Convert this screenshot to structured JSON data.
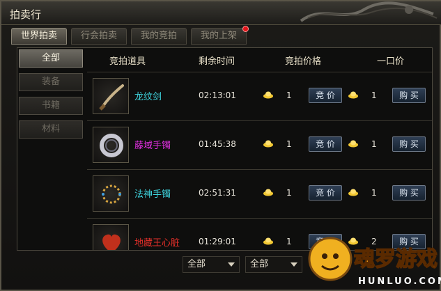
{
  "window": {
    "title": "拍卖行"
  },
  "tabs": [
    {
      "label": "世界拍卖",
      "active": true
    },
    {
      "label": "行会拍卖",
      "active": false
    },
    {
      "label": "我的竞拍",
      "active": false
    },
    {
      "label": "我的上架",
      "active": false,
      "has_notification": true
    }
  ],
  "categories": [
    {
      "label": "全部",
      "active": true
    },
    {
      "label": "装备",
      "active": false
    },
    {
      "label": "书籍",
      "active": false
    },
    {
      "label": "材料",
      "active": false
    }
  ],
  "columns": {
    "item": "竞拍道具",
    "time": "剩余时间",
    "bid": "竞拍价格",
    "buyout": "一口价"
  },
  "items": [
    {
      "name": "龙纹剑",
      "name_color": "#3fd6e0",
      "icon": "sword-icon",
      "time": "02:13:01",
      "bid": "1",
      "bid_button": "竞 价",
      "buyout": "1",
      "buy_button": "购 买"
    },
    {
      "name": "藤域手镯",
      "name_color": "#e030e0",
      "icon": "bracelet-icon",
      "time": "01:45:38",
      "bid": "1",
      "bid_button": "竞 价",
      "buyout": "1",
      "buy_button": "购 买"
    },
    {
      "name": "法神手镯",
      "name_color": "#3fd6e0",
      "icon": "bead-bracelet-icon",
      "time": "02:51:31",
      "bid": "1",
      "bid_button": "竞 价",
      "buyout": "1",
      "buy_button": "购 买"
    },
    {
      "name": "地藏王心脏",
      "name_color": "#e8302a",
      "icon": "heart-icon",
      "time": "01:29:01",
      "bid": "1",
      "bid_button": "竞 价",
      "buyout": "2",
      "buy_button": "购 买"
    }
  ],
  "filters": [
    {
      "selected": "全部"
    },
    {
      "selected": "全部"
    }
  ],
  "watermark": {
    "text": "魂罗游戏",
    "subtext": "HUNLUO.COM"
  },
  "colors": {
    "gold": "#f2c832",
    "accent_blue": "#2f3f55"
  }
}
